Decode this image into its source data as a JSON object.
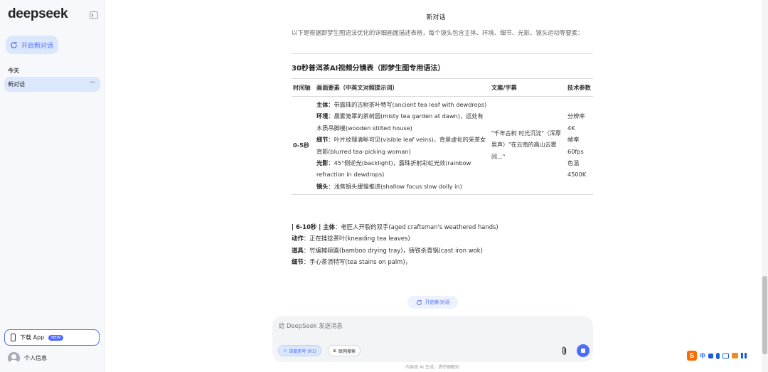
{
  "sidebar": {
    "logo": "deepseek",
    "new_chat_label": "开启新对话",
    "section_today": "今天",
    "history": [
      {
        "label": "新对话",
        "more": "···"
      }
    ],
    "download_label": "下载 App",
    "download_badge": "NEW",
    "profile_label": "个人信息"
  },
  "header": {
    "title": "新对话"
  },
  "message": {
    "intro": "以下是根据即梦生图语法优化的详细画面描述表格，每个镜头包含主体、环境、细节、光影、镜头运动等要素：",
    "table_heading": "30秒普洱茶AI视频分镜表（即梦生图专用语法）",
    "table": {
      "headers": [
        "时间轴",
        "画面要素（中英文对照提示词）",
        "文案/字幕",
        "技术参数"
      ],
      "rows": [
        {
          "time": "0-5秒",
          "elements": [
            {
              "key": "主体",
              "text": "：带露珠的古树茶叶特写(ancient tea leaf with dewdrops)"
            },
            {
              "key": "环境",
              "text": "：晨雾笼罩的茶树园(misty tea garden at dawn)，远处有木质吊脚楼(wooden stilted house)"
            },
            {
              "key": "细节",
              "text": "：叶片纹理清晰可见(visible leaf veins)，背景虚化的采茶女背影(blurred tea-picking woman)"
            },
            {
              "key": "光影",
              "text": "：45°侧逆光(backlight)，露珠折射彩虹光效(rainbow refraction in dewdrops)"
            },
            {
              "key": "镜头",
              "text": "：浅焦镜头缓慢推进(shallow focus slow dolly in)"
            }
          ],
          "copy": "\"千年古树 时光沉淀\"（浑厚男声）\"在云南的高山云雾间...\"",
          "tech": [
            "分辨率",
            "4K",
            "帧率",
            "60fps",
            "色温",
            "4500K"
          ]
        }
      ]
    },
    "continuation": [
      {
        "prefix": "| 6-10秒 | ",
        "key": "主体",
        "text": "：老匠人开裂的双手(aged craftsman's weathered hands)"
      },
      {
        "prefix": "",
        "key": "动作",
        "text": "：正在揉捻茶叶(kneading tea leaves)"
      },
      {
        "prefix": "",
        "key": "道具",
        "text": "：竹编摊晾匾(bamboo drying tray)，铸铁杀青锅(cast iron wok)"
      },
      {
        "prefix": "",
        "key": "细节",
        "text": "：手心茶渍特写(tea stains on palm)，"
      }
    ]
  },
  "regenerate_label": "开启新对话",
  "composer": {
    "placeholder": "给 DeepSeek 发送消息",
    "deep_think_label": "深度思考 (R1)",
    "web_search_label": "联网搜索"
  },
  "disclaimer": "内容由 AI 生成，请仔细甄别",
  "ime": {
    "logo": "S",
    "lang": "中"
  },
  "colors": {
    "accent": "#4d6bfe",
    "sidebar_bg": "#f7f8fc",
    "selected_bg": "#dbe7fd"
  }
}
